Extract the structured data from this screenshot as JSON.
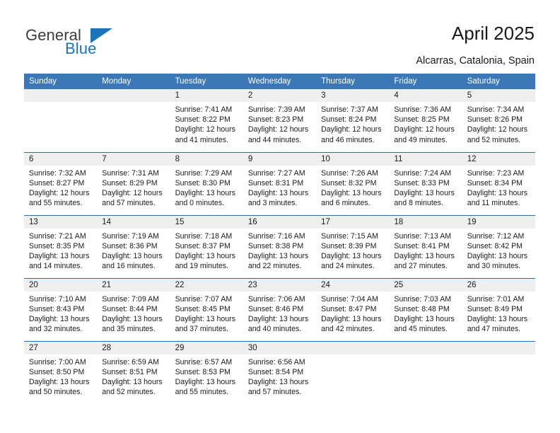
{
  "brand": {
    "name_part1": "General",
    "name_part2": "Blue",
    "triangle_icon": "blue-triangle-icon",
    "color_dark": "#3c3c3c",
    "color_blue": "#1b74bb"
  },
  "header": {
    "title": "April 2025",
    "location": "Alcarras, Catalonia, Spain",
    "accent_color": "#3b78b5",
    "separator_color": "#2e6da8",
    "daynum_band_color": "#efefef"
  },
  "weekdays": [
    "Sunday",
    "Monday",
    "Tuesday",
    "Wednesday",
    "Thursday",
    "Friday",
    "Saturday"
  ],
  "labels": {
    "sunrise": "Sunrise:",
    "sunset": "Sunset:",
    "daylight": "Daylight:"
  },
  "weeks": [
    [
      {
        "day": "",
        "empty": true
      },
      {
        "day": "",
        "empty": true
      },
      {
        "day": "1",
        "sunrise": "Sunrise: 7:41 AM",
        "sunset": "Sunset: 8:22 PM",
        "daylight_1": "Daylight: 12 hours",
        "daylight_2": "and 41 minutes."
      },
      {
        "day": "2",
        "sunrise": "Sunrise: 7:39 AM",
        "sunset": "Sunset: 8:23 PM",
        "daylight_1": "Daylight: 12 hours",
        "daylight_2": "and 44 minutes."
      },
      {
        "day": "3",
        "sunrise": "Sunrise: 7:37 AM",
        "sunset": "Sunset: 8:24 PM",
        "daylight_1": "Daylight: 12 hours",
        "daylight_2": "and 46 minutes."
      },
      {
        "day": "4",
        "sunrise": "Sunrise: 7:36 AM",
        "sunset": "Sunset: 8:25 PM",
        "daylight_1": "Daylight: 12 hours",
        "daylight_2": "and 49 minutes."
      },
      {
        "day": "5",
        "sunrise": "Sunrise: 7:34 AM",
        "sunset": "Sunset: 8:26 PM",
        "daylight_1": "Daylight: 12 hours",
        "daylight_2": "and 52 minutes."
      }
    ],
    [
      {
        "day": "6",
        "sunrise": "Sunrise: 7:32 AM",
        "sunset": "Sunset: 8:27 PM",
        "daylight_1": "Daylight: 12 hours",
        "daylight_2": "and 55 minutes."
      },
      {
        "day": "7",
        "sunrise": "Sunrise: 7:31 AM",
        "sunset": "Sunset: 8:29 PM",
        "daylight_1": "Daylight: 12 hours",
        "daylight_2": "and 57 minutes."
      },
      {
        "day": "8",
        "sunrise": "Sunrise: 7:29 AM",
        "sunset": "Sunset: 8:30 PM",
        "daylight_1": "Daylight: 13 hours",
        "daylight_2": "and 0 minutes."
      },
      {
        "day": "9",
        "sunrise": "Sunrise: 7:27 AM",
        "sunset": "Sunset: 8:31 PM",
        "daylight_1": "Daylight: 13 hours",
        "daylight_2": "and 3 minutes."
      },
      {
        "day": "10",
        "sunrise": "Sunrise: 7:26 AM",
        "sunset": "Sunset: 8:32 PM",
        "daylight_1": "Daylight: 13 hours",
        "daylight_2": "and 6 minutes."
      },
      {
        "day": "11",
        "sunrise": "Sunrise: 7:24 AM",
        "sunset": "Sunset: 8:33 PM",
        "daylight_1": "Daylight: 13 hours",
        "daylight_2": "and 8 minutes."
      },
      {
        "day": "12",
        "sunrise": "Sunrise: 7:23 AM",
        "sunset": "Sunset: 8:34 PM",
        "daylight_1": "Daylight: 13 hours",
        "daylight_2": "and 11 minutes."
      }
    ],
    [
      {
        "day": "13",
        "sunrise": "Sunrise: 7:21 AM",
        "sunset": "Sunset: 8:35 PM",
        "daylight_1": "Daylight: 13 hours",
        "daylight_2": "and 14 minutes."
      },
      {
        "day": "14",
        "sunrise": "Sunrise: 7:19 AM",
        "sunset": "Sunset: 8:36 PM",
        "daylight_1": "Daylight: 13 hours",
        "daylight_2": "and 16 minutes."
      },
      {
        "day": "15",
        "sunrise": "Sunrise: 7:18 AM",
        "sunset": "Sunset: 8:37 PM",
        "daylight_1": "Daylight: 13 hours",
        "daylight_2": "and 19 minutes."
      },
      {
        "day": "16",
        "sunrise": "Sunrise: 7:16 AM",
        "sunset": "Sunset: 8:38 PM",
        "daylight_1": "Daylight: 13 hours",
        "daylight_2": "and 22 minutes."
      },
      {
        "day": "17",
        "sunrise": "Sunrise: 7:15 AM",
        "sunset": "Sunset: 8:39 PM",
        "daylight_1": "Daylight: 13 hours",
        "daylight_2": "and 24 minutes."
      },
      {
        "day": "18",
        "sunrise": "Sunrise: 7:13 AM",
        "sunset": "Sunset: 8:41 PM",
        "daylight_1": "Daylight: 13 hours",
        "daylight_2": "and 27 minutes."
      },
      {
        "day": "19",
        "sunrise": "Sunrise: 7:12 AM",
        "sunset": "Sunset: 8:42 PM",
        "daylight_1": "Daylight: 13 hours",
        "daylight_2": "and 30 minutes."
      }
    ],
    [
      {
        "day": "20",
        "sunrise": "Sunrise: 7:10 AM",
        "sunset": "Sunset: 8:43 PM",
        "daylight_1": "Daylight: 13 hours",
        "daylight_2": "and 32 minutes."
      },
      {
        "day": "21",
        "sunrise": "Sunrise: 7:09 AM",
        "sunset": "Sunset: 8:44 PM",
        "daylight_1": "Daylight: 13 hours",
        "daylight_2": "and 35 minutes."
      },
      {
        "day": "22",
        "sunrise": "Sunrise: 7:07 AM",
        "sunset": "Sunset: 8:45 PM",
        "daylight_1": "Daylight: 13 hours",
        "daylight_2": "and 37 minutes."
      },
      {
        "day": "23",
        "sunrise": "Sunrise: 7:06 AM",
        "sunset": "Sunset: 8:46 PM",
        "daylight_1": "Daylight: 13 hours",
        "daylight_2": "and 40 minutes."
      },
      {
        "day": "24",
        "sunrise": "Sunrise: 7:04 AM",
        "sunset": "Sunset: 8:47 PM",
        "daylight_1": "Daylight: 13 hours",
        "daylight_2": "and 42 minutes."
      },
      {
        "day": "25",
        "sunrise": "Sunrise: 7:03 AM",
        "sunset": "Sunset: 8:48 PM",
        "daylight_1": "Daylight: 13 hours",
        "daylight_2": "and 45 minutes."
      },
      {
        "day": "26",
        "sunrise": "Sunrise: 7:01 AM",
        "sunset": "Sunset: 8:49 PM",
        "daylight_1": "Daylight: 13 hours",
        "daylight_2": "and 47 minutes."
      }
    ],
    [
      {
        "day": "27",
        "sunrise": "Sunrise: 7:00 AM",
        "sunset": "Sunset: 8:50 PM",
        "daylight_1": "Daylight: 13 hours",
        "daylight_2": "and 50 minutes."
      },
      {
        "day": "28",
        "sunrise": "Sunrise: 6:59 AM",
        "sunset": "Sunset: 8:51 PM",
        "daylight_1": "Daylight: 13 hours",
        "daylight_2": "and 52 minutes."
      },
      {
        "day": "29",
        "sunrise": "Sunrise: 6:57 AM",
        "sunset": "Sunset: 8:53 PM",
        "daylight_1": "Daylight: 13 hours",
        "daylight_2": "and 55 minutes."
      },
      {
        "day": "30",
        "sunrise": "Sunrise: 6:56 AM",
        "sunset": "Sunset: 8:54 PM",
        "daylight_1": "Daylight: 13 hours",
        "daylight_2": "and 57 minutes."
      },
      {
        "day": "",
        "empty": true
      },
      {
        "day": "",
        "empty": true
      },
      {
        "day": "",
        "empty": true
      }
    ]
  ]
}
